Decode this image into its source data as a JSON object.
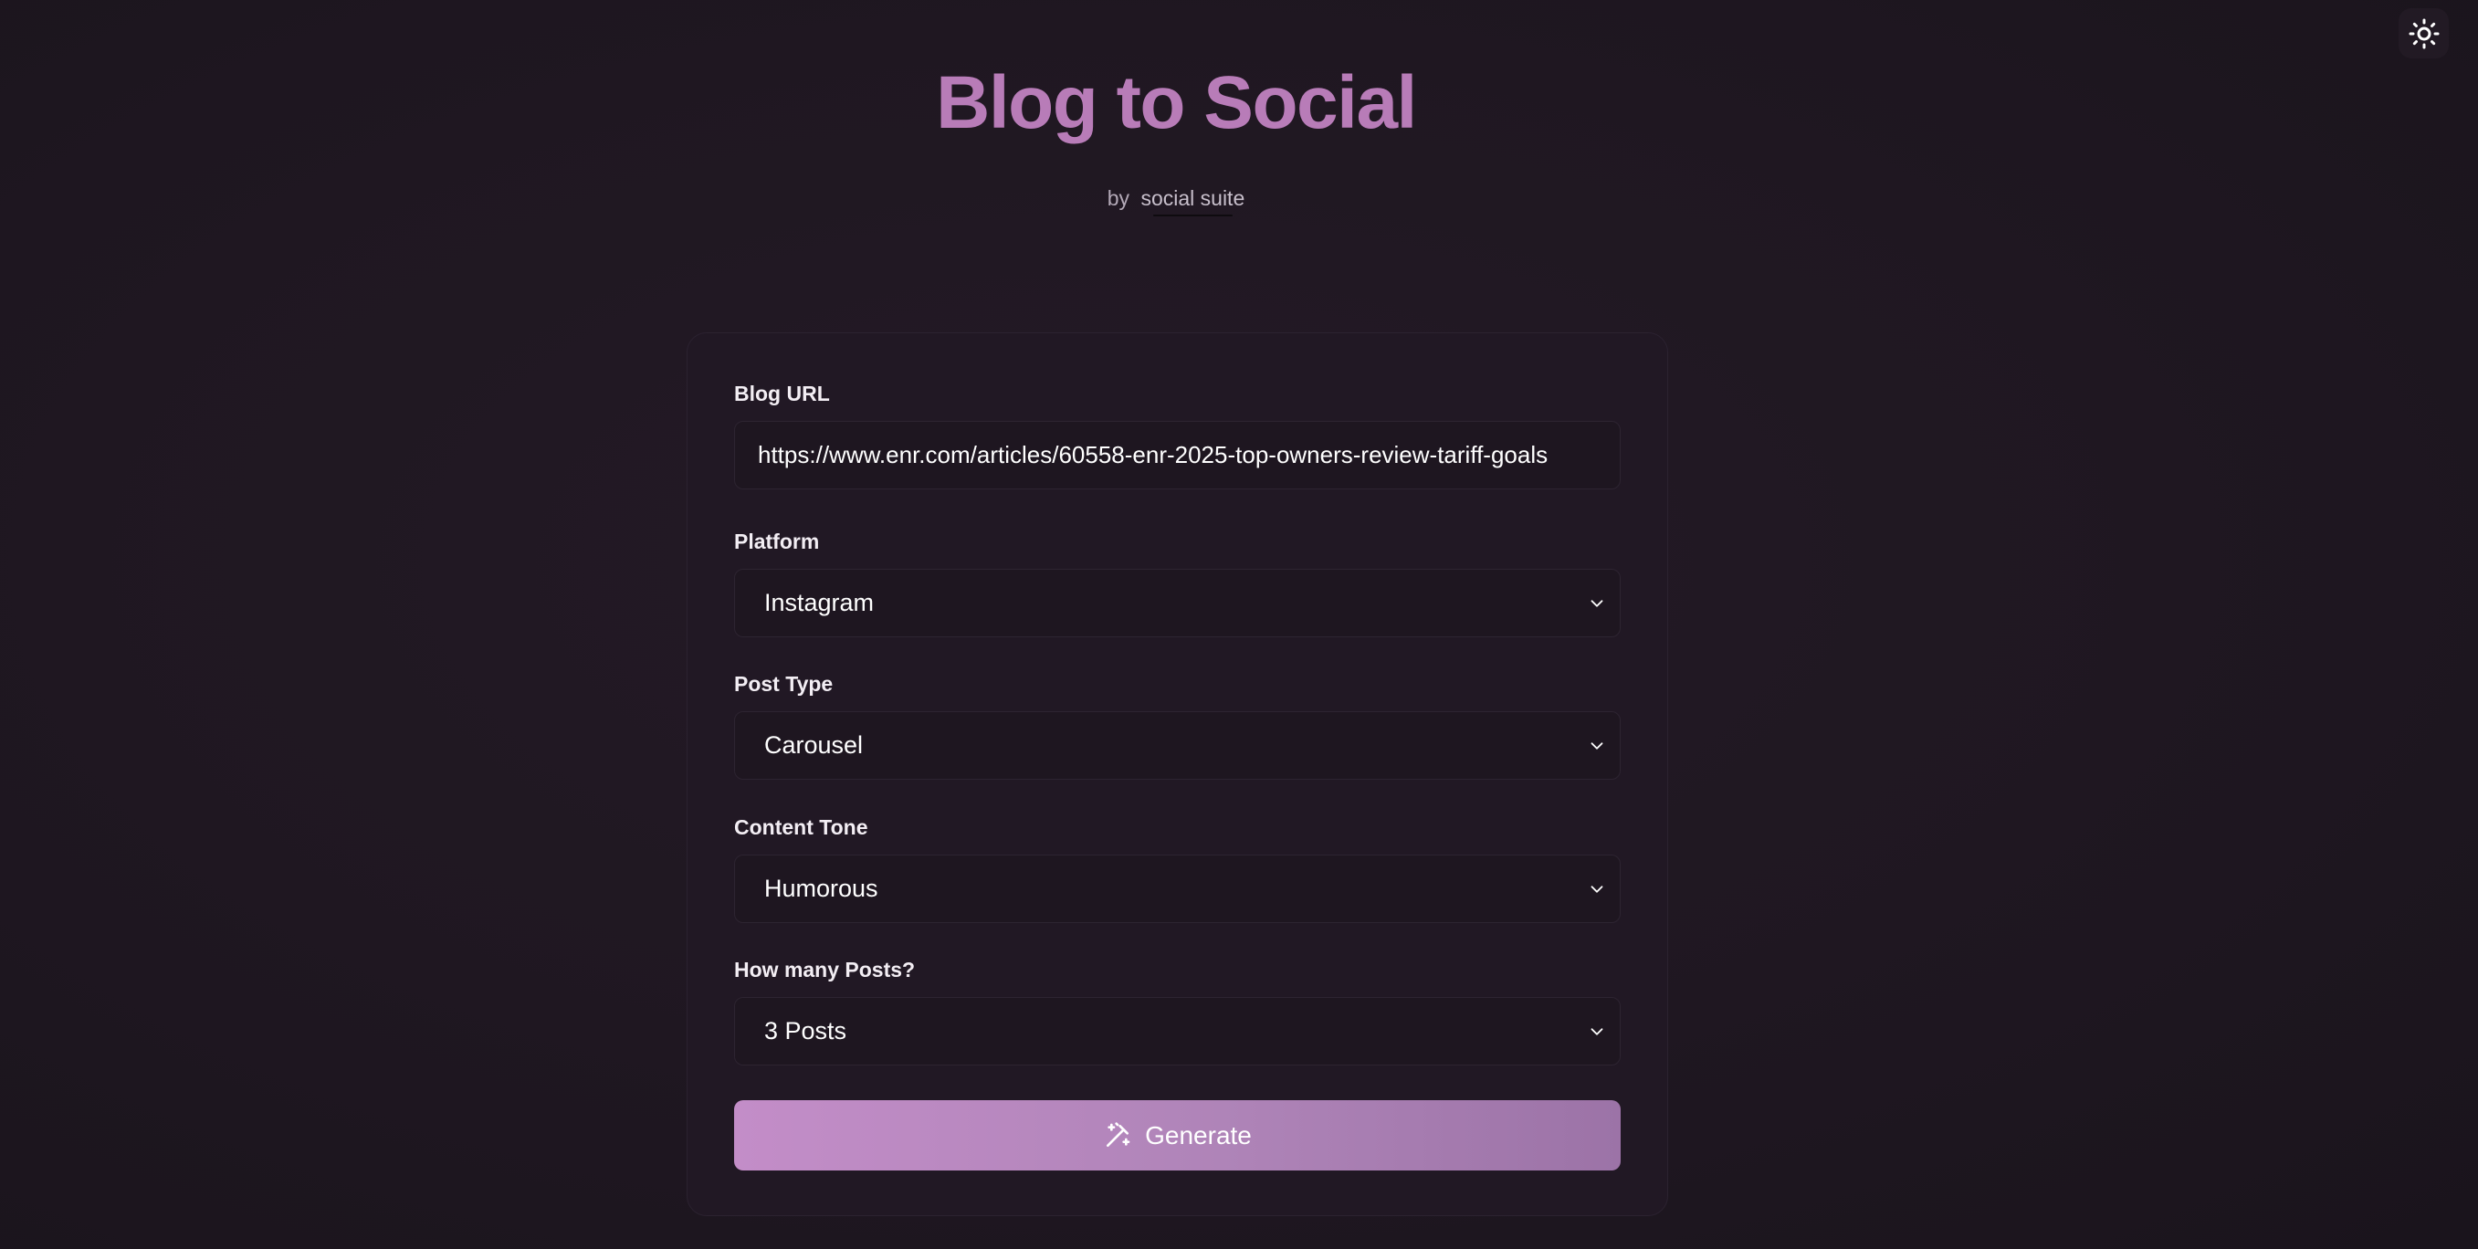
{
  "header": {
    "title": "Blog to Social",
    "by_prefix": "by",
    "brand": "social suite"
  },
  "theme_toggle": {
    "icon": "sun-icon"
  },
  "form": {
    "blog_url": {
      "label": "Blog URL",
      "value": "https://www.enr.com/articles/60558-enr-2025-top-owners-review-tariff-goals"
    },
    "platform": {
      "label": "Platform",
      "value": "Instagram",
      "icon": "chevron-down-icon"
    },
    "post_type": {
      "label": "Post Type",
      "value": "Carousel",
      "icon": "chevron-down-icon"
    },
    "content_tone": {
      "label": "Content Tone",
      "value": "Humorous",
      "icon": "chevron-down-icon"
    },
    "post_count": {
      "label": "How many Posts?",
      "value": "3 Posts",
      "icon": "chevron-down-icon"
    },
    "generate": {
      "label": "Generate",
      "icon": "magic-wand-icon"
    }
  },
  "colors": {
    "accent": "#b87cb8",
    "button_start": "#c38dc8",
    "button_end": "#9c73a7",
    "background": "#1f1721",
    "card": "#211824"
  }
}
